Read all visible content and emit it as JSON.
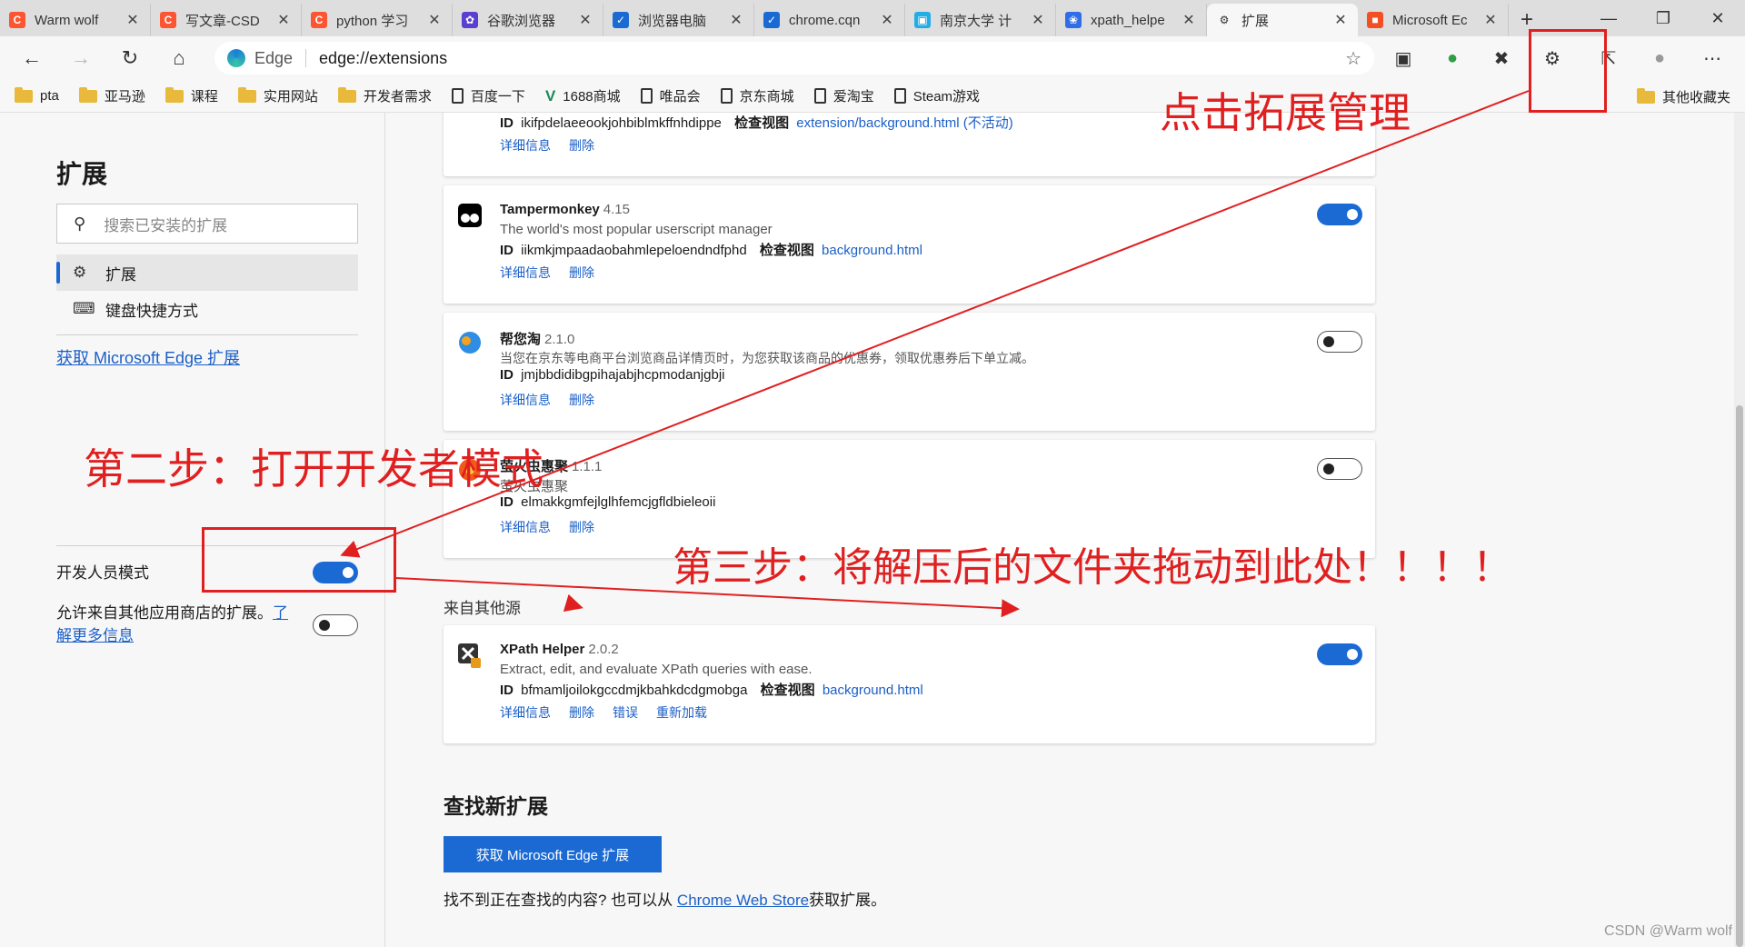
{
  "tabs": [
    {
      "label": "Warm wolf",
      "icon": "csdn-icon",
      "color": "#fc5531",
      "glyph": "C"
    },
    {
      "label": "写文章-CSD",
      "icon": "csdn-icon",
      "color": "#fc5531",
      "glyph": "C"
    },
    {
      "label": "python 学习",
      "icon": "csdn-icon",
      "color": "#fc5531",
      "glyph": "C"
    },
    {
      "label": "谷歌浏览器",
      "icon": "puzzle-site-icon",
      "color": "#5b3fd0",
      "glyph": "✿"
    },
    {
      "label": "浏览器电脑",
      "icon": "check-icon",
      "color": "#1b6ad4",
      "glyph": "✓"
    },
    {
      "label": "chrome.cqn",
      "icon": "check-icon",
      "color": "#1b6ad4",
      "glyph": "✓"
    },
    {
      "label": "南京大学 计",
      "icon": "bilibili-icon",
      "color": "#23ade5",
      "glyph": "▣"
    },
    {
      "label": "xpath_helpe",
      "icon": "baidu-icon",
      "color": "#2f6ee8",
      "glyph": "❀"
    },
    {
      "label": "扩展",
      "icon": "extensions-icon",
      "color": "#f7f7f7",
      "glyph": "⚙"
    },
    {
      "label": "Microsoft Ec",
      "icon": "microsoft-icon",
      "color": "#f25022",
      "glyph": "■"
    }
  ],
  "address": {
    "brand": "Edge",
    "url": "edge://extensions"
  },
  "bookmarks": [
    {
      "label": "pta",
      "type": "folder"
    },
    {
      "label": "亚马逊",
      "type": "folder"
    },
    {
      "label": "课程",
      "type": "folder"
    },
    {
      "label": "实用网站",
      "type": "folder"
    },
    {
      "label": "开发者需求",
      "type": "folder"
    },
    {
      "label": "百度一下",
      "type": "page"
    },
    {
      "label": "1688商城",
      "type": "v"
    },
    {
      "label": "唯品会",
      "type": "page"
    },
    {
      "label": "京东商城",
      "type": "page"
    },
    {
      "label": "爱淘宝",
      "type": "page"
    },
    {
      "label": "Steam游戏",
      "type": "page"
    }
  ],
  "bookmarks_other": "其他收藏夹",
  "sidebar": {
    "title": "扩展",
    "search_placeholder": "搜索已安装的扩展",
    "items": [
      {
        "label": "扩展",
        "icon": "extensions-icon"
      },
      {
        "label": "键盘快捷方式",
        "icon": "keyboard-icon"
      }
    ],
    "get_link": "获取 Microsoft Edge 扩展",
    "dev_mode_label": "开发人员模式",
    "dev_mode_on": true,
    "allow_text": "允许来自其他应用商店的扩展。",
    "learn_more": "了解更多信息",
    "allow_on": false
  },
  "extensions": [
    {
      "name": "",
      "version": "",
      "desc": "",
      "id": "ikifpdelaeeookjohbiblmkffnhdippe",
      "inspect_label": "检查视图",
      "inspect_link": "extension/background.html (不活动)",
      "actions": [
        "详细信息",
        "删除"
      ],
      "enabled": null
    },
    {
      "name": "Tampermonkey",
      "version": "4.15",
      "desc": "The world's most popular userscript manager",
      "id": "iikmkjmpaadaobahmlepeloendndfphd",
      "inspect_label": "检查视图",
      "inspect_link": "background.html",
      "actions": [
        "详细信息",
        "删除"
      ],
      "enabled": true
    },
    {
      "name": "帮您淘",
      "version": "2.1.0",
      "desc": "当您在京东等电商平台浏览商品详情页时，为您获取该商品的优惠券，领取优惠券后下单立减。",
      "id": "jmjbbdidibgpihajabjhcpmodanjgbji",
      "inspect_label": "",
      "inspect_link": "",
      "actions": [
        "详细信息",
        "删除"
      ],
      "enabled": false
    },
    {
      "name": "萤火虫惠聚",
      "version": "1.1.1",
      "desc": "萤火虫惠聚",
      "id": "elmakkgmfejlglhfemcjgfldbieleoii",
      "inspect_label": "",
      "inspect_link": "",
      "actions": [
        "详细信息",
        "删除"
      ],
      "enabled": false
    }
  ],
  "other_source_title": "来自其他源",
  "other_extensions": [
    {
      "name": "XPath Helper",
      "version": "2.0.2",
      "desc": "Extract, edit, and evaluate XPath queries with ease.",
      "id": "bfmamljoilokgccdmjkbahkdcdgmobga",
      "inspect_label": "检查视图",
      "inspect_link": "background.html",
      "actions": [
        "详细信息",
        "删除",
        "错误",
        "重新加载"
      ],
      "enabled": true
    }
  ],
  "find": {
    "title": "查找新扩展",
    "button": "获取 Microsoft Edge 扩展",
    "text_before": "找不到正在查找的内容? 也可以从",
    "store_link": "Chrome Web Store",
    "text_after": "获取扩展。"
  },
  "id_label": "ID",
  "annotations": {
    "step1": "点击拓展管理",
    "step2": "第二步：打开开发者模式",
    "step3": "第三步：将解压后的文件夹拖动到此处！！！！"
  },
  "watermark": "CSDN @Warm wolf",
  "colors": {
    "accent": "#1b6ad4",
    "annotation": "#e02020"
  }
}
